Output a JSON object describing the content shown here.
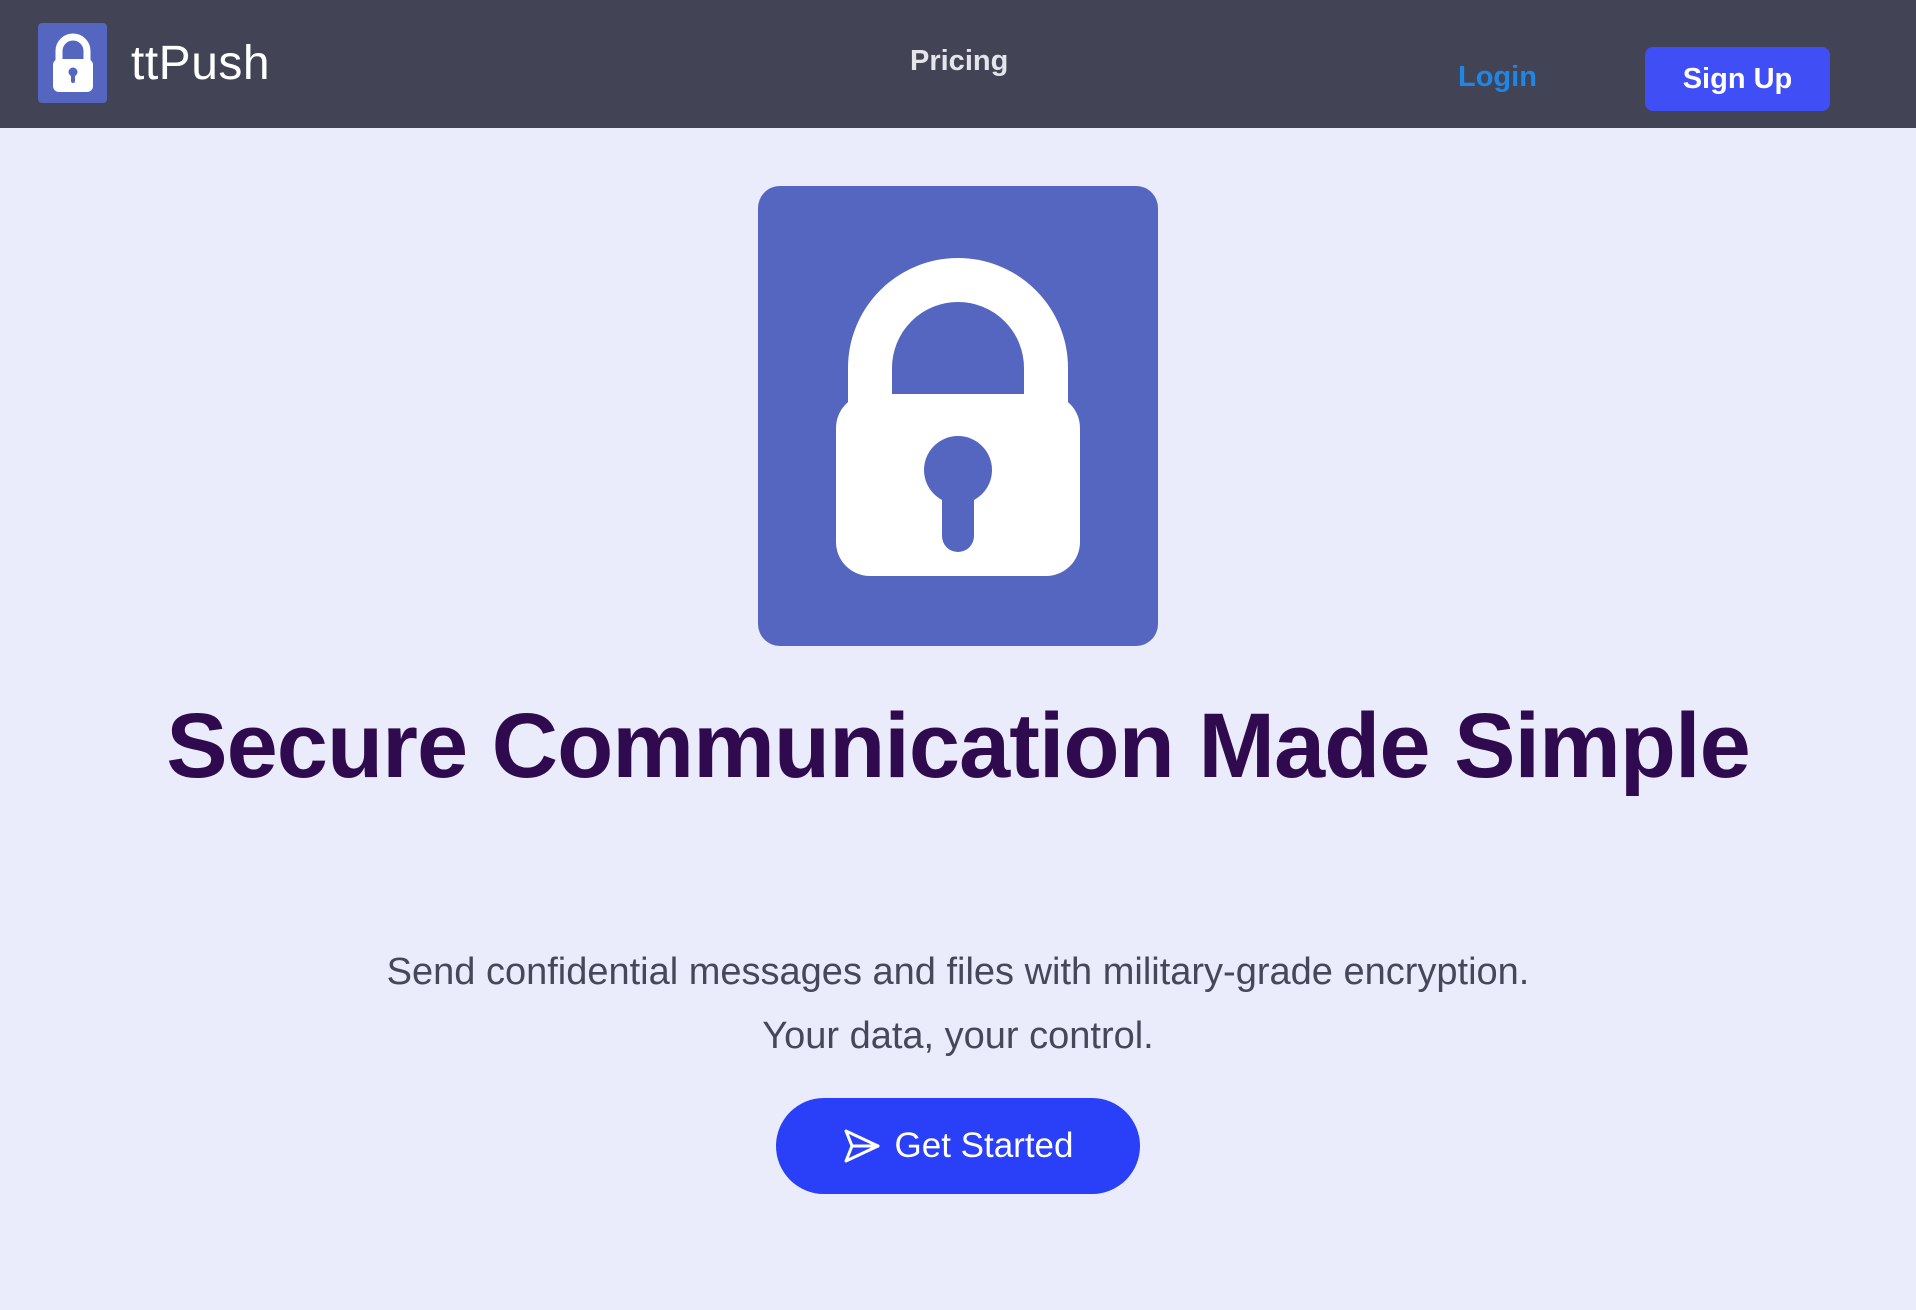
{
  "nav": {
    "brand_name": "ttPush",
    "brand_icon": "lock-icon",
    "pricing_label": "Pricing",
    "login_label": "Login",
    "signup_label": "Sign Up"
  },
  "hero": {
    "logo_icon": "lock-icon",
    "title": "Secure Communication Made Simple",
    "subtitle_line1": "Send confidential messages and files with military-grade encryption.",
    "subtitle_line2": "Your data, your control.",
    "cta_label": "Get Started",
    "cta_icon": "send-icon"
  },
  "colors": {
    "navbar_bg": "#424456",
    "page_bg": "#eaebfb",
    "brand_blue": "#5466c0",
    "primary_button": "#3f4ff5",
    "cta_button": "#2a3ff8",
    "login_link": "#1f86e6",
    "title_text": "#2f0a4f",
    "subtitle_text": "#47475a"
  }
}
